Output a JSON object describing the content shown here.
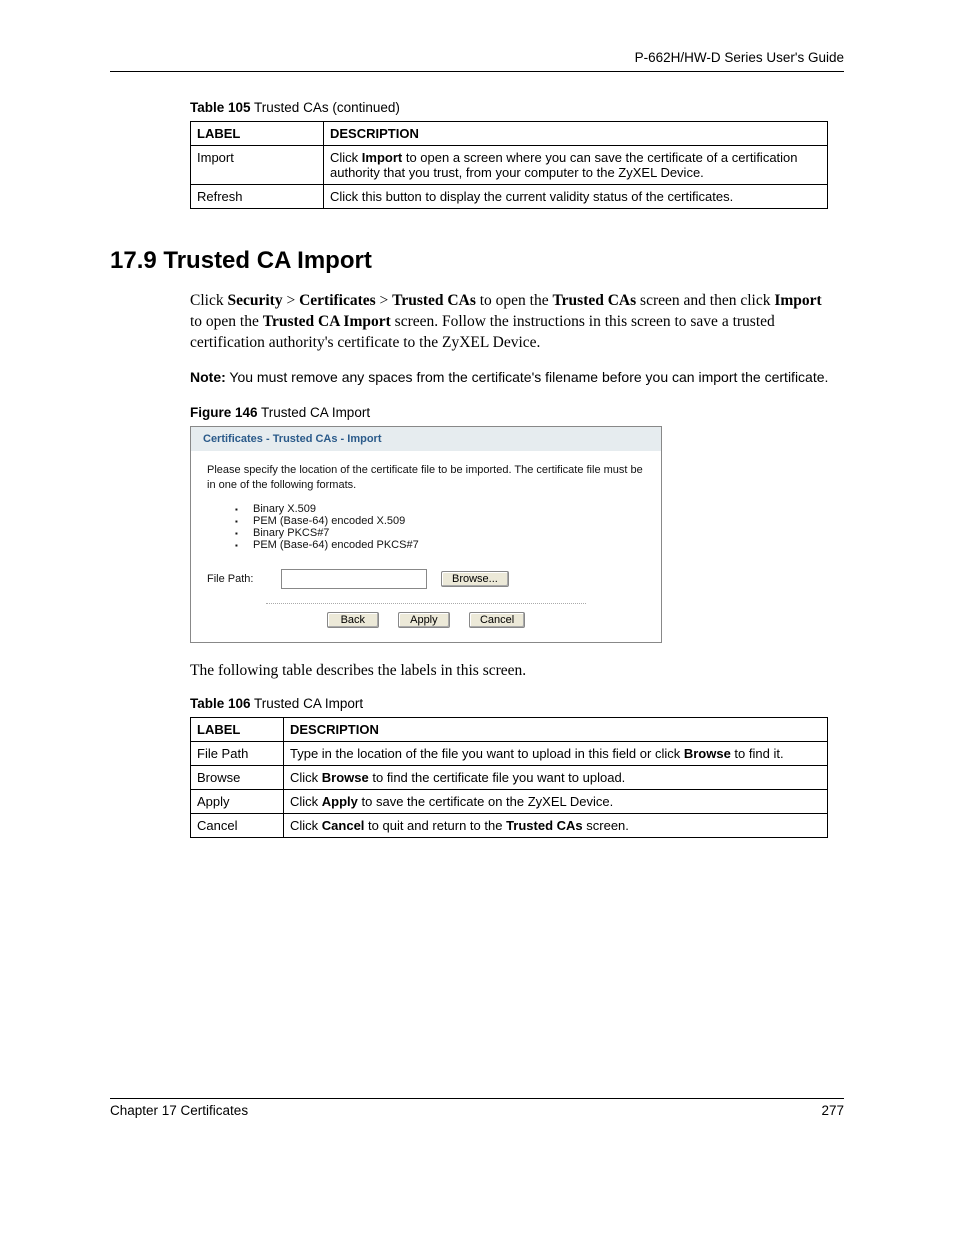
{
  "header": {
    "guide_title": "P-662H/HW-D Series User's Guide"
  },
  "table105": {
    "caption_bold": "Table 105",
    "caption_rest": "   Trusted CAs (continued)",
    "headers": {
      "label": "LABEL",
      "description": "DESCRIPTION"
    },
    "rows": [
      {
        "label": "Import",
        "desc_pre": "Click ",
        "desc_b": "Import",
        "desc_post": " to open a screen where you can save the certificate of a certification authority that you trust, from your computer to the ZyXEL Device."
      },
      {
        "label": "Refresh",
        "desc_pre": "",
        "desc_b": "",
        "desc_post": "Click this button to display the current validity status of the certificates."
      }
    ]
  },
  "section": {
    "heading": "17.9  Trusted CA Import",
    "para1_parts": {
      "t1": "Click ",
      "b1": "Security",
      "t2": " > ",
      "b2": "Certificates",
      "t3": " > ",
      "b3": "Trusted CAs",
      "t4": " to open the ",
      "b4": "Trusted CAs",
      "t5": " screen and then click ",
      "b5": "Import",
      "t6": " to open the ",
      "b6": "Trusted CA Import",
      "t7": " screen. Follow the instructions in this screen to save a trusted certification authority's certificate to the ZyXEL Device."
    },
    "note_label": "Note:",
    "note_text": " You must remove any spaces from the certificate's filename before you can import the certificate."
  },
  "figure": {
    "caption_bold": "Figure 146",
    "caption_rest": "   Trusted CA Import",
    "title": "Certificates - Trusted CAs - Import",
    "instructions": "Please specify the location of the certificate file to be imported. The certificate file must be in one of the following formats.",
    "formats": [
      "Binary X.509",
      "PEM (Base-64) encoded X.509",
      "Binary PKCS#7",
      "PEM (Base-64) encoded PKCS#7"
    ],
    "file_label": "File Path:",
    "browse": "Browse...",
    "buttons": {
      "back": "Back",
      "apply": "Apply",
      "cancel": "Cancel"
    }
  },
  "para2": "The following table describes the labels in this screen.",
  "table106": {
    "caption_bold": "Table 106",
    "caption_rest": "   Trusted CA Import",
    "headers": {
      "label": "LABEL",
      "description": "DESCRIPTION"
    },
    "rows": [
      {
        "label": "File Path",
        "pre": "Type in the location of the file you want to upload in this field or click ",
        "b": "Browse",
        "post": " to find it."
      },
      {
        "label": "Browse",
        "pre": "Click ",
        "b": "Browse",
        "post": " to find the certificate file you want to upload."
      },
      {
        "label": "Apply",
        "pre": "Click ",
        "b": "Apply",
        "post": " to save the certificate on the ZyXEL Device."
      },
      {
        "label": "Cancel",
        "pre": "Click ",
        "b": "Cancel",
        "post": " to quit and return to the ",
        "b2": "Trusted CAs",
        "post2": " screen."
      }
    ]
  },
  "footer": {
    "chapter": "Chapter 17 Certificates",
    "page": "277"
  }
}
